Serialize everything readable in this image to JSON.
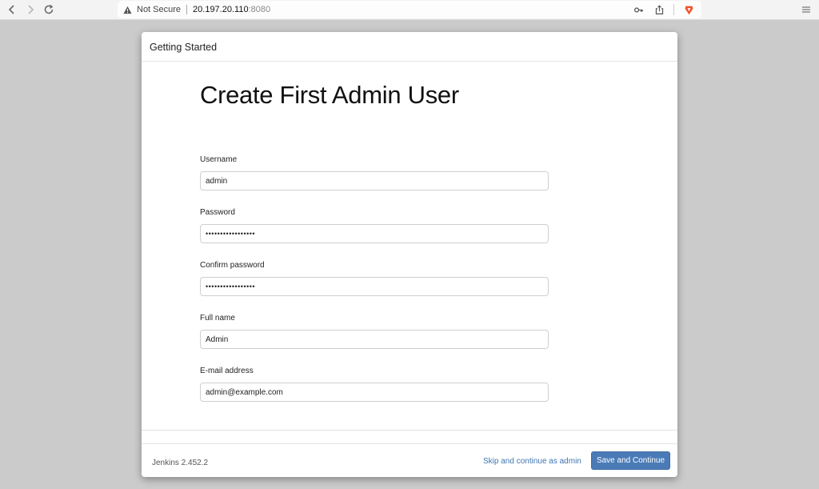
{
  "browser": {
    "security_label": "Not Secure",
    "url_host": "20.197.20.110",
    "url_port": ":8080"
  },
  "dialog": {
    "header_title": "Getting Started",
    "page_title": "Create First Admin User",
    "fields": [
      {
        "label": "Username",
        "value": "admin"
      },
      {
        "label": "Password",
        "value": "•••••••••••••••••"
      },
      {
        "label": "Confirm password",
        "value": "•••••••••••••••••"
      },
      {
        "label": "Full name",
        "value": "Admin"
      },
      {
        "label": "E-mail address",
        "value": "admin@example.com"
      }
    ],
    "footer": {
      "version": "Jenkins 2.452.2",
      "skip_label": "Skip and continue as admin",
      "save_label": "Save and Continue"
    }
  },
  "colors": {
    "primary_button": "#4a7bb7",
    "link": "#3d76b3",
    "backdrop": "#cbcbcb"
  }
}
